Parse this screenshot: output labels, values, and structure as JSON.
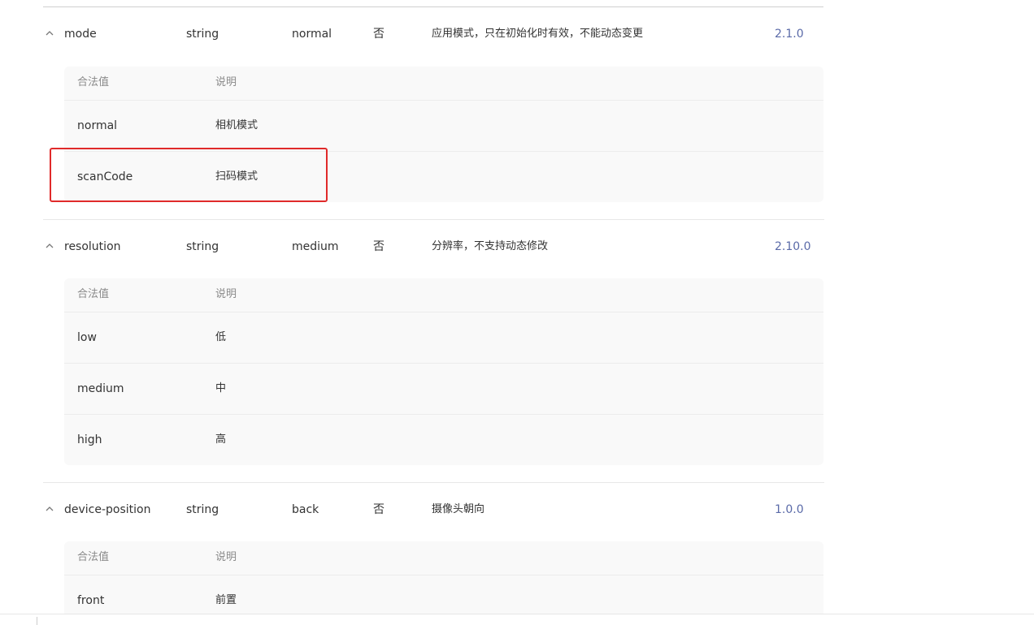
{
  "values_header": {
    "value": "合法值",
    "desc": "说明"
  },
  "properties": [
    {
      "name": "mode",
      "type": "string",
      "default": "normal",
      "required": "否",
      "description": "应用模式，只在初始化时有效，不能动态变更",
      "version": "2.1.0",
      "values": [
        {
          "value": "normal",
          "desc": "相机模式"
        },
        {
          "value": "scanCode",
          "desc": "扫码模式"
        }
      ]
    },
    {
      "name": "resolution",
      "type": "string",
      "default": "medium",
      "required": "否",
      "description": "分辨率，不支持动态修改",
      "version": "2.10.0",
      "values": [
        {
          "value": "low",
          "desc": "低"
        },
        {
          "value": "medium",
          "desc": "中"
        },
        {
          "value": "high",
          "desc": "高"
        }
      ]
    },
    {
      "name": "device-position",
      "type": "string",
      "default": "back",
      "required": "否",
      "description": "摄像头朝向",
      "version": "1.0.0",
      "values": [
        {
          "value": "front",
          "desc": "前置"
        }
      ]
    }
  ],
  "colors": {
    "highlight_border": "#e02a2a",
    "version_text": "#5a6aa8",
    "values_bg": "#f9f9f9"
  },
  "icons": {
    "collapse": "chevron-up-icon"
  }
}
